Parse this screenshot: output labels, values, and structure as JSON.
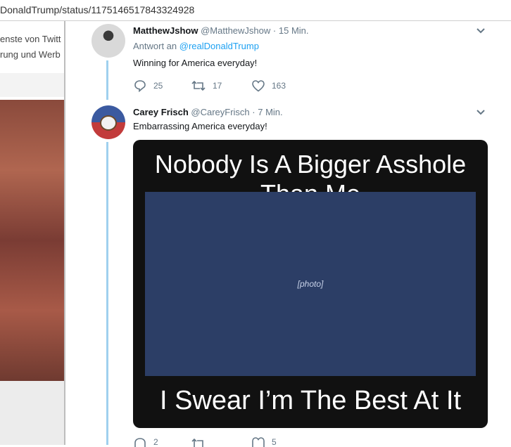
{
  "browser": {
    "url": "DonaldTrump/status/1175146517843324928"
  },
  "left_panel": {
    "ad_line_1": "enste von Twitt",
    "ad_line_2": "rung und Werb"
  },
  "tweets": [
    {
      "name": "MatthewJshow",
      "handle": "@MatthewJshow",
      "sep": "·",
      "time": "15 Min.",
      "reply_prefix": "Antwort an",
      "reply_to": "@realDonaldTrump",
      "text": "Winning for America everyday!",
      "replies": "25",
      "retweets": "17",
      "likes": "163",
      "icons": [
        "reply-icon",
        "retweet-icon",
        "like-icon",
        "chevron-down-icon"
      ]
    },
    {
      "name": "Carey Frisch",
      "handle": "@CareyFrisch",
      "sep": "·",
      "time": "7 Min.",
      "text": "Embarrassing America everyday!",
      "media": {
        "top_caption": "Nobody Is A Bigger Asshole Than Me",
        "bottom_caption": "I Swear I’m The Best At It"
      },
      "replies": "2",
      "retweets": "",
      "likes": "5"
    }
  ],
  "colors": {
    "link": "#1da1f2",
    "meta": "#657786",
    "thread_line": "#9fd0ee"
  }
}
